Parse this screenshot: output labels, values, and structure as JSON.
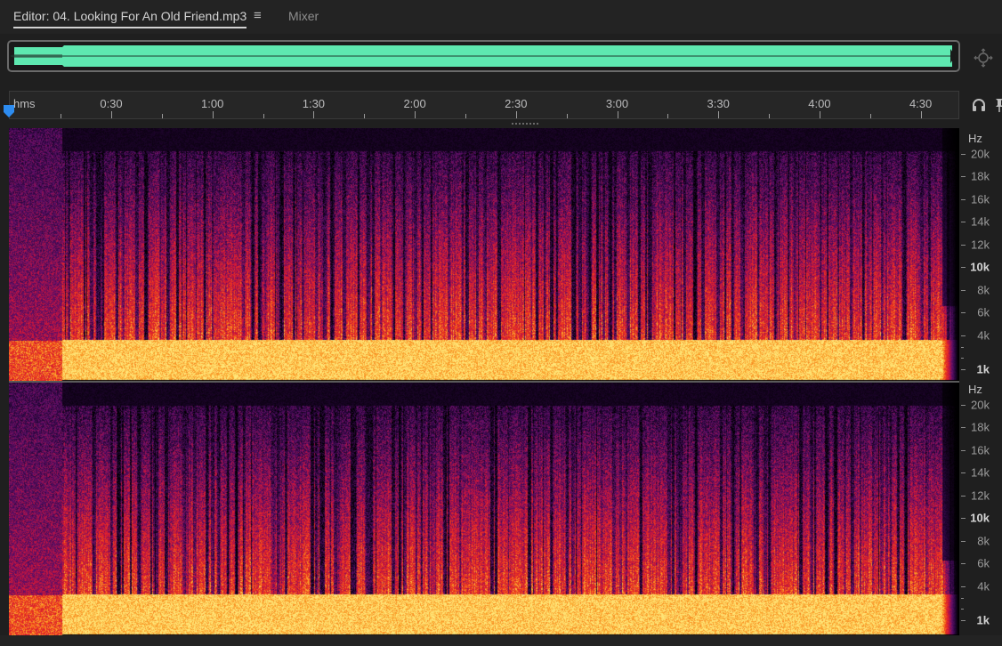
{
  "tabs": {
    "editor_label": "Editor: 04. Looking For An Old Friend.mp3",
    "menu_glyph": "≡",
    "mixer_label": "Mixer"
  },
  "ruler": {
    "unit_label": "hms",
    "time_labels": [
      "0:30",
      "1:00",
      "1:30",
      "2:00",
      "2:30",
      "3:00",
      "3:30",
      "4:00",
      "4:30"
    ]
  },
  "frequency_axis": {
    "unit_label": "Hz",
    "labels": [
      "20k",
      "18k",
      "16k",
      "14k",
      "12k",
      "10k",
      "8k",
      "6k",
      "4k",
      "1k"
    ]
  },
  "colors": {
    "waveform": "#5ee8b0",
    "spectral_low": "#ffd060",
    "spectral_mid": "#e8202c",
    "spectral_high": "#3a0c56",
    "playhead": "#2d8cf0"
  },
  "icons": {
    "zoom": "zoom-navigator-icon",
    "playhead": "playhead-icon",
    "headphones": "headphones-icon",
    "pin": "pin-icon"
  }
}
